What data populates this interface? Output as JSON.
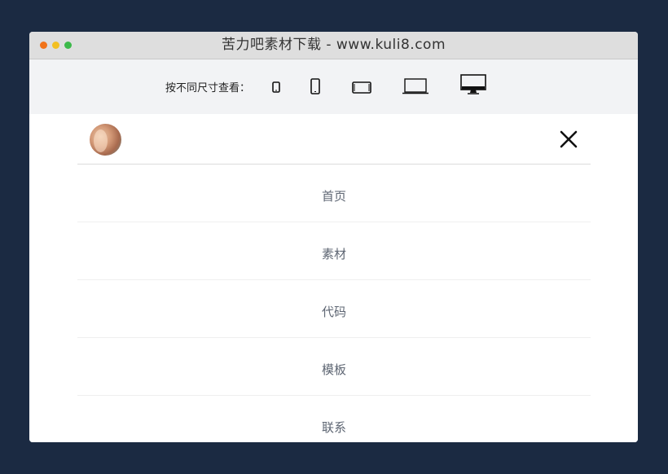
{
  "window": {
    "title": "苦力吧素材下载 - www.kuli8.com",
    "traffic_lights": [
      "#f1731a",
      "#f3c023",
      "#3cb94a"
    ]
  },
  "toolbar": {
    "label": "按不同尺寸查看：",
    "devices": [
      {
        "icon": "small-phone-icon"
      },
      {
        "icon": "phone-icon"
      },
      {
        "icon": "tablet-landscape-icon"
      },
      {
        "icon": "laptop-icon"
      },
      {
        "icon": "desktop-monitor-icon"
      }
    ]
  },
  "header": {
    "avatar": "avatar",
    "close_icon": "close-icon"
  },
  "menu": {
    "items": [
      {
        "label": "首页"
      },
      {
        "label": "素材"
      },
      {
        "label": "代码"
      },
      {
        "label": "模板"
      },
      {
        "label": "联系"
      }
    ]
  },
  "colors": {
    "background": "#1b2a42",
    "titlebar": "#dedede",
    "toolbar": "#f2f3f5",
    "menu_text": "#5e6673"
  }
}
